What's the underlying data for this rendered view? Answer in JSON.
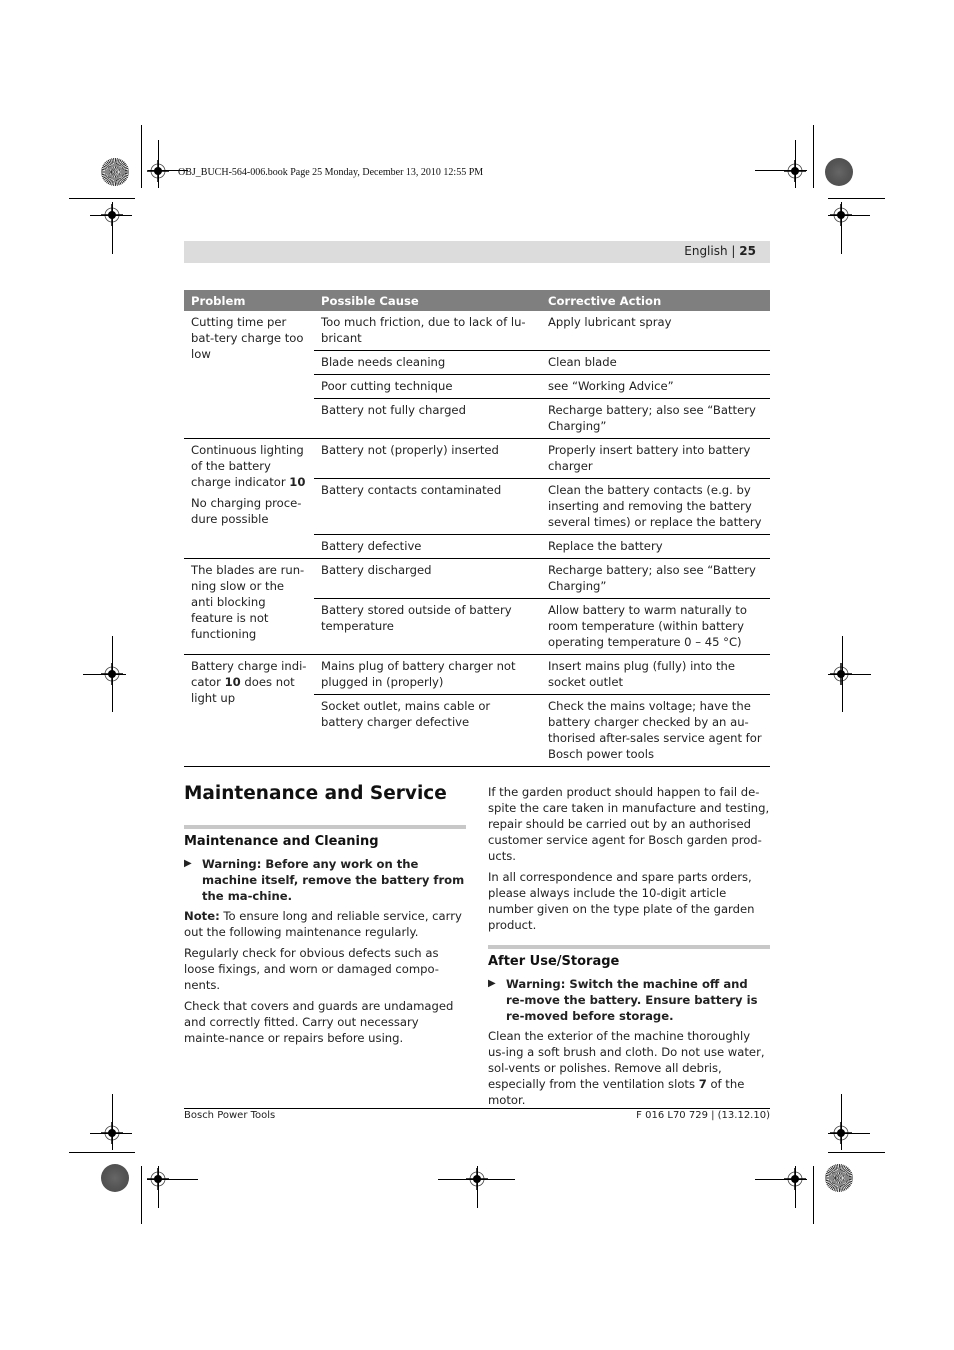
{
  "print_info": "OBJ_BUCH-564-006.book  Page 25  Monday, December 13, 2010  12:55 PM",
  "header": {
    "language": "English",
    "separator": "|",
    "page_number": "25"
  },
  "troubleshooting_table": {
    "columns": [
      "Problem",
      "Possible Cause",
      "Corrective Action"
    ],
    "groups": [
      {
        "problem": [
          "Cutting time per bat-tery charge too low"
        ],
        "rows": [
          {
            "cause": "Too much friction, due to lack of lu-bricant",
            "action": "Apply lubricant spray"
          },
          {
            "cause": "Blade needs cleaning",
            "action": "Clean blade"
          },
          {
            "cause": "Poor cutting technique",
            "action": "see “Working Advice”"
          },
          {
            "cause": "Battery not fully charged",
            "action": "Recharge battery; also see “Battery Charging”"
          }
        ]
      },
      {
        "problem": [
          "Continuous lighting of the battery charge indicator",
          "No charging proce-dure possible"
        ],
        "problem_ref": "10",
        "rows": [
          {
            "cause": "Battery not (properly) inserted",
            "action": "Properly insert battery into battery charger"
          },
          {
            "cause": "Battery contacts contaminated",
            "action": "Clean the battery contacts (e.g. by inserting and removing the battery several times) or replace the battery"
          },
          {
            "cause": "Battery defective",
            "action": "Replace the battery"
          }
        ]
      },
      {
        "problem": [
          "The blades are run-ning slow or the anti blocking feature is not functioning"
        ],
        "rows": [
          {
            "cause": "Battery discharged",
            "action": "Recharge battery; also see “Battery Charging”"
          },
          {
            "cause": "Battery stored outside of battery temperature",
            "action": "Allow battery to warm naturally to room temperature (within battery operating temperature 0 – 45 °C)"
          }
        ]
      },
      {
        "problem_prefix": "Battery charge indi-cator",
        "problem_ref": "10",
        "problem_suffix": "does not light up",
        "rows": [
          {
            "cause": "Mains plug of battery charger not plugged in (properly)",
            "action": "Insert mains plug (fully) into the socket outlet"
          },
          {
            "cause": "Socket outlet, mains cable or battery charger defective",
            "action": "Check the mains voltage; have the battery charger checked by an au-thorised after-sales service agent for Bosch power tools"
          }
        ]
      }
    ]
  },
  "maintenance": {
    "title": "Maintenance and Service",
    "cleaning": {
      "heading": "Maintenance and Cleaning",
      "warning": "Warning: Before any work on the machine itself, remove the battery from the ma-chine.",
      "note_label": "Note:",
      "note_text": " To ensure long and reliable service, carry out the following maintenance regularly.",
      "paragraphs": [
        "Regularly check for obvious defects such as loose fixings, and worn or damaged compo-nents.",
        "Check that covers and guards are undamaged and correctly fitted. Carry out necessary mainte-nance or repairs before using."
      ]
    },
    "service_paragraphs": [
      "If the garden product should happen to fail de-spite the care taken in manufacture and testing, repair should be carried out by an authorised customer service agent for Bosch garden prod-ucts.",
      "In all correspondence and spare parts orders, please always include the 10-digit article number given on the type plate of the garden product."
    ],
    "storage": {
      "heading": "After Use/Storage",
      "warning": "Warning: Switch the machine off and re-move the battery. Ensure battery is re-moved before storage.",
      "text_before": "Clean the exterior of the machine thoroughly us-ing a soft brush and cloth. Do not use water, sol-vents or polishes. Remove all debris, especially from the ventilation slots ",
      "text_ref": "7",
      "text_after": " of the motor."
    }
  },
  "footer": {
    "left": "Bosch Power Tools",
    "right": "F 016 L70 729 | (13.12.10)"
  },
  "icons": {
    "warning_bullet": "▶"
  }
}
